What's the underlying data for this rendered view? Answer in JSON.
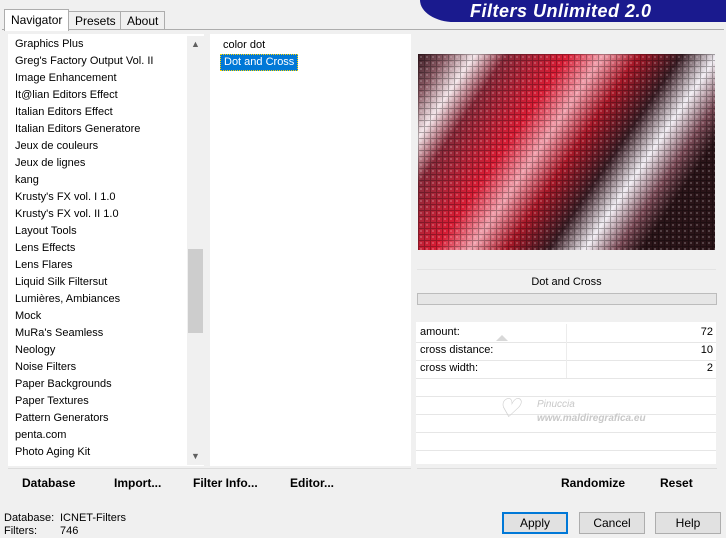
{
  "header": {
    "title": "Filters Unlimited 2.0"
  },
  "tabs": [
    {
      "label": "Navigator",
      "active": true
    },
    {
      "label": "Presets",
      "active": false
    },
    {
      "label": "About",
      "active": false
    }
  ],
  "categories": [
    "Graphics Plus",
    "Greg's Factory Output Vol. II",
    "Image Enhancement",
    "It@lian Editors Effect",
    "Italian Editors Effect",
    "Italian Editors Generatore",
    "Jeux de couleurs",
    "Jeux de lignes",
    "kang",
    "Krusty's FX vol. I 1.0",
    "Krusty's FX vol. II 1.0",
    "Layout Tools",
    "Lens Effects",
    "Lens Flares",
    "Liquid Silk Filtersut",
    "Lumières, Ambiances",
    "Mock",
    "MuRa's Seamless",
    "Neology",
    "Noise Filters",
    "Paper Backgrounds",
    "Paper Textures",
    "Pattern Generators",
    "penta.com",
    "Photo Aging Kit"
  ],
  "filters": [
    {
      "label": "color dot",
      "selected": false
    },
    {
      "label": "Dot and Cross",
      "selected": true
    }
  ],
  "preview": {
    "filter_name": "Dot and Cross"
  },
  "params": [
    {
      "label": "amount:",
      "value": "72"
    },
    {
      "label": "cross distance:",
      "value": "10"
    },
    {
      "label": "cross width:",
      "value": "2"
    }
  ],
  "watermark": {
    "line1": "Pinuccia",
    "line2": "www.maldiregrafica.eu"
  },
  "left_buttons": {
    "database": "Database",
    "import": "Import...",
    "filter_info": "Filter Info...",
    "editor": "Editor..."
  },
  "right_buttons": {
    "randomize": "Randomize",
    "reset": "Reset"
  },
  "status": {
    "database_label": "Database:",
    "database_value": "ICNET-Filters",
    "filters_label": "Filters:",
    "filters_value": "746"
  },
  "dialog_buttons": {
    "apply": "Apply",
    "cancel": "Cancel",
    "help": "Help"
  },
  "colors": {
    "accent": "#0078d7",
    "banner": "#1a1a8e",
    "preview_red": "#c0102a"
  }
}
